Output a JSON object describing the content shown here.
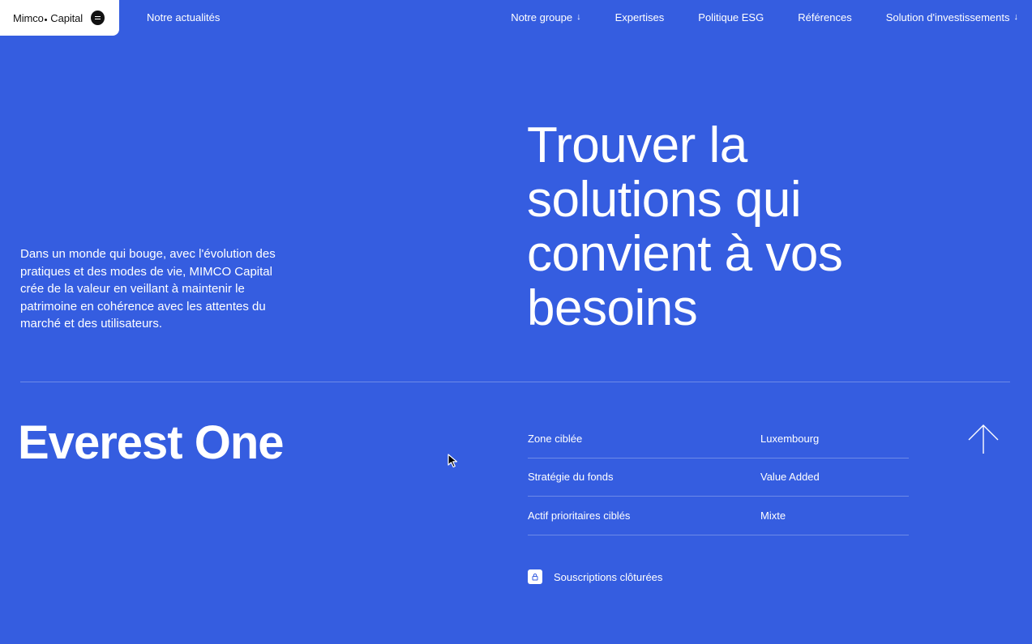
{
  "header": {
    "logo": "Mimco",
    "logo_suffix": "Capital",
    "news_link": "Notre actualités",
    "nav": [
      {
        "label": "Notre groupe",
        "has_dropdown": true
      },
      {
        "label": "Expertises",
        "has_dropdown": false
      },
      {
        "label": "Politique ESG",
        "has_dropdown": false
      },
      {
        "label": "Références",
        "has_dropdown": false
      },
      {
        "label": "Solution d'investissements",
        "has_dropdown": true
      }
    ]
  },
  "hero": {
    "intro": "Dans un monde qui bouge, avec l'évolution des pratiques et des modes de vie, MIMCO Capital crée de la valeur en veillant à maintenir le patrimoine en cohérence avec les attentes du marché et des utilisateurs.",
    "headline": "Trouver la solutions qui convient à vos besoins"
  },
  "fund": {
    "name": "Everest One",
    "details": [
      {
        "label": "Zone ciblée",
        "value": "Luxembourg"
      },
      {
        "label": "Stratégie du fonds",
        "value": "Value Added"
      },
      {
        "label": "Actif prioritaires ciblés",
        "value": "Mixte"
      }
    ],
    "status": "Souscriptions clôturées"
  },
  "colors": {
    "background": "#355DE0",
    "text": "#FFFFFF",
    "logo_bg": "#FFFFFF"
  },
  "icons": {
    "menu": "menu-icon",
    "arrow_down": "arrow-down-icon",
    "arrow_up": "arrow-up-icon",
    "lock": "lock-icon",
    "cursor": "cursor-icon"
  }
}
